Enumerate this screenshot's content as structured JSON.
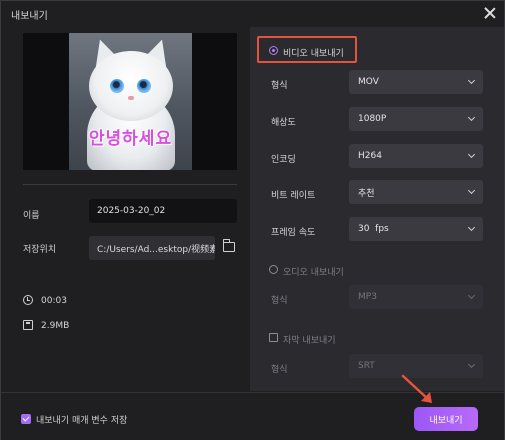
{
  "window": {
    "title": "내보내기"
  },
  "preview": {
    "overlay_text": "안녕하세요"
  },
  "file": {
    "name_label": "이름",
    "name_value": "2025-03-20_02",
    "path_label": "저장위치",
    "path_value": "C:/Users/Ad...esktop/视频素材",
    "duration": "00:03",
    "size": "2.9MB"
  },
  "video_export": {
    "label": "비디오 내보내기",
    "selected": true,
    "fields": [
      {
        "label": "형식",
        "value": "MOV"
      },
      {
        "label": "해상도",
        "value": "1080P"
      },
      {
        "label": "인코딩",
        "value": "H264"
      },
      {
        "label": "비트 레이트",
        "value": "추천"
      },
      {
        "label": "프레임 속도",
        "value": "30  fps"
      }
    ]
  },
  "audio_export": {
    "label": "오디오 내보내기",
    "selected": false,
    "format_label": "형식",
    "format_value": "MP3"
  },
  "subtitle_export": {
    "label": "자막 내보내기",
    "checked": false,
    "format_label": "형식",
    "format_value": "SRT"
  },
  "footer": {
    "remember_label": "내보내기 매개 변수 저장",
    "remember_checked": true,
    "export_button": "내보내기"
  },
  "colors": {
    "accent": "#a46cf2",
    "highlight_box": "#e5533d",
    "background": "#1f1f22",
    "panel": "#2a2a2f"
  }
}
